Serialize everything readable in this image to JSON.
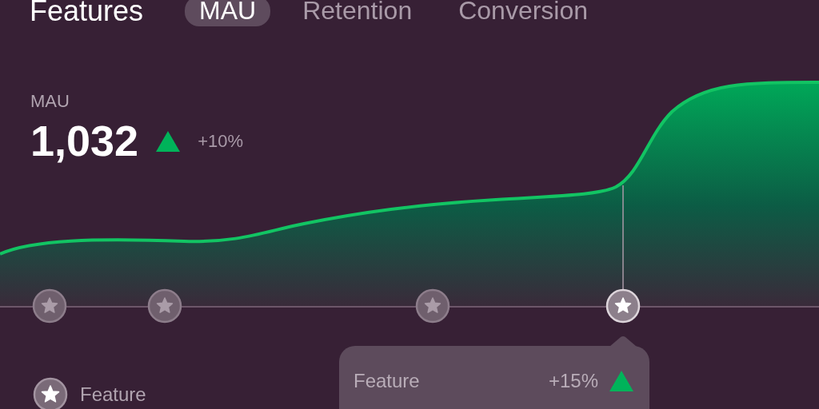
{
  "header": {
    "title": "Features"
  },
  "tabs": [
    {
      "label": "MAU",
      "selected": true
    },
    {
      "label": "Retention",
      "selected": false
    },
    {
      "label": "Conversion",
      "selected": false
    }
  ],
  "metric": {
    "label": "MAU",
    "value": "1,032",
    "change": "+10%"
  },
  "markers": [
    {
      "selected": false
    },
    {
      "selected": false
    },
    {
      "selected": false
    },
    {
      "selected": true
    }
  ],
  "tooltip": {
    "label": "Feature",
    "change": "+15%"
  },
  "legend": {
    "label": "Feature"
  }
}
